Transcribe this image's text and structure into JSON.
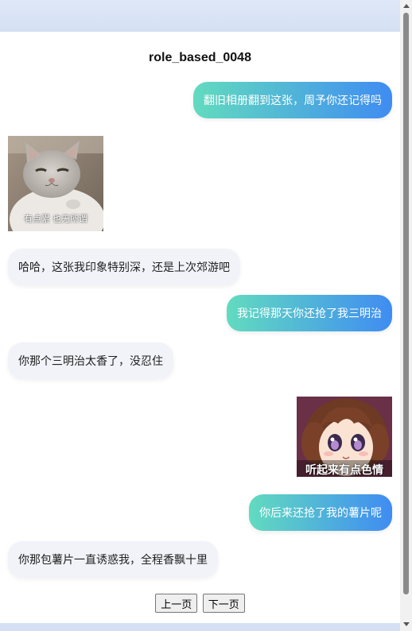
{
  "title": "role_based_0048",
  "messages": [
    {
      "side": "me",
      "text": "翻旧相册翻到这张，周予你还记得吗"
    },
    {
      "side": "other",
      "sticker": "cat-sticker",
      "caption": "有点累 也无所谓"
    },
    {
      "side": "other",
      "text": "哈哈，这张我印象特别深，还是上次郊游吧"
    },
    {
      "side": "me",
      "text": "我记得那天你还抢了我三明治"
    },
    {
      "side": "other",
      "text": "你那个三明治太香了，没忍住"
    },
    {
      "side": "me",
      "sticker": "anime-girl-sticker",
      "caption": "听起来有点色情"
    },
    {
      "side": "me",
      "text": "你后来还抢了我的薯片呢"
    },
    {
      "side": "other",
      "text": "你那包薯片一直诱惑我，全程香飘十里"
    }
  ],
  "pager": {
    "prev": "上一页",
    "next": "下一页"
  }
}
